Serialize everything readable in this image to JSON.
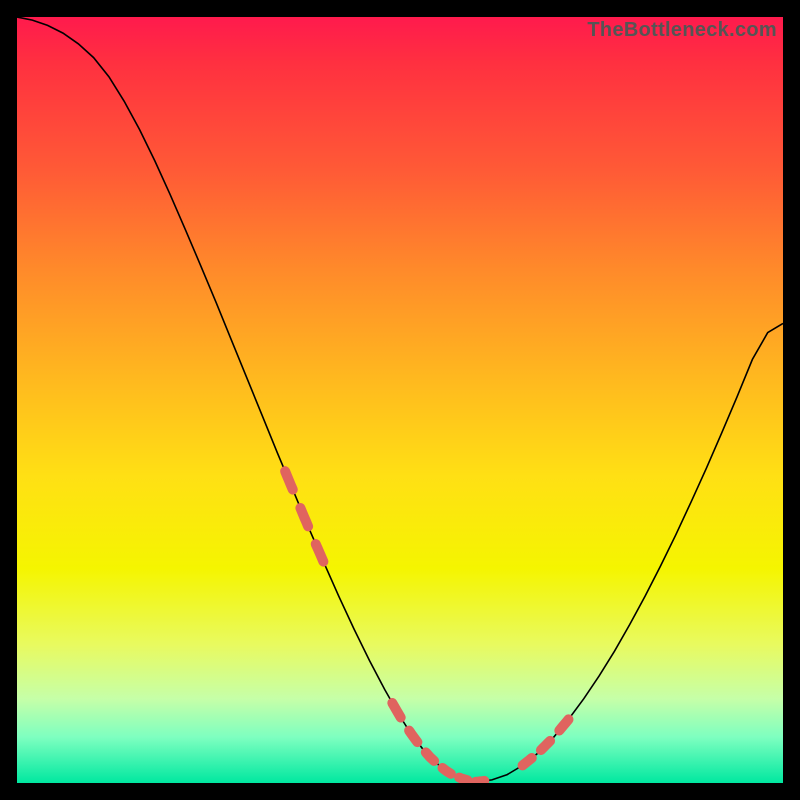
{
  "watermark": "TheBottleneck.com",
  "colors": {
    "frame": "#000000",
    "gradient_top": "#ff1a4d",
    "gradient_bottom": "#00e8a0",
    "curve": "#000000",
    "highlight": "#e0645f"
  },
  "chart_data": {
    "type": "line",
    "title": "",
    "xlabel": "",
    "ylabel": "",
    "xlim": [
      0,
      100
    ],
    "ylim": [
      0,
      100
    ],
    "grid": false,
    "legend": false,
    "x": [
      0,
      2,
      4,
      6,
      8,
      10,
      12,
      14,
      16,
      18,
      20,
      22,
      24,
      26,
      28,
      30,
      32,
      34,
      36,
      38,
      40,
      42,
      44,
      46,
      48,
      50,
      51,
      52,
      53,
      54,
      55,
      56,
      57,
      58,
      59,
      60,
      62,
      64,
      66,
      68,
      70,
      72,
      74,
      76,
      78,
      80,
      82,
      84,
      86,
      88,
      90,
      92,
      94,
      96,
      98,
      100
    ],
    "y": [
      100,
      99.6,
      98.9,
      97.9,
      96.5,
      94.7,
      92.2,
      89,
      85.3,
      81.2,
      76.8,
      72.2,
      67.5,
      62.7,
      57.8,
      52.9,
      48,
      43.1,
      38.3,
      33.5,
      28.9,
      24.4,
      20.1,
      16,
      12.2,
      8.7,
      7.1,
      5.7,
      4.4,
      3.3,
      2.4,
      1.6,
      1,
      0.6,
      0.3,
      0.15,
      0.4,
      1.1,
      2.3,
      3.9,
      5.9,
      8.3,
      11,
      14,
      17.2,
      20.7,
      24.4,
      28.3,
      32.4,
      36.7,
      41.1,
      45.7,
      50.4,
      55.3,
      58.8,
      60
    ],
    "highlight_segments": [
      {
        "x0": 35,
        "x1": 40,
        "dashes": 3,
        "note": "left descending highlight"
      },
      {
        "x0": 49,
        "x1": 61,
        "dashes": 6,
        "note": "valley floor highlight"
      },
      {
        "x0": 66,
        "x1": 72,
        "dashes": 3,
        "note": "right ascending highlight"
      }
    ]
  }
}
